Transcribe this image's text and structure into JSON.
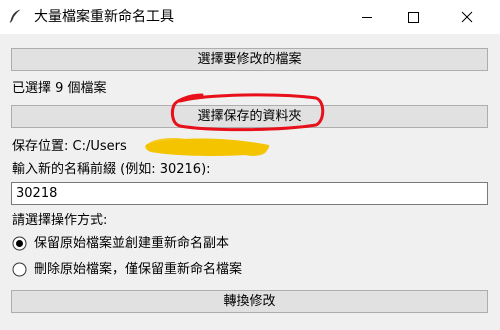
{
  "window": {
    "title": "大量檔案重新命名工具",
    "icon": "feather-icon",
    "controls": [
      "minimize-icon",
      "maximize-icon",
      "close-icon"
    ]
  },
  "select_files_button": "選擇要修改的檔案",
  "selected_count_text": "已選擇 9 個檔案",
  "select_folder_button": "選擇保存的資料夾",
  "save_location_text": "保存位置: C:/Users",
  "prefix_label": "輸入新的名稱前綴 (例如: 30216):",
  "prefix_value": "30218",
  "operation_label": "請選擇操作方式:",
  "options": [
    {
      "label": "保留原始檔案並創建重新命名副本",
      "selected": true
    },
    {
      "label": "刪除原始檔案，僅保留重新命名檔案",
      "selected": false
    }
  ],
  "convert_button": "轉換修改",
  "colors": {
    "annotation_circle": "#e8101a",
    "redaction_mark": "#f4c400"
  }
}
